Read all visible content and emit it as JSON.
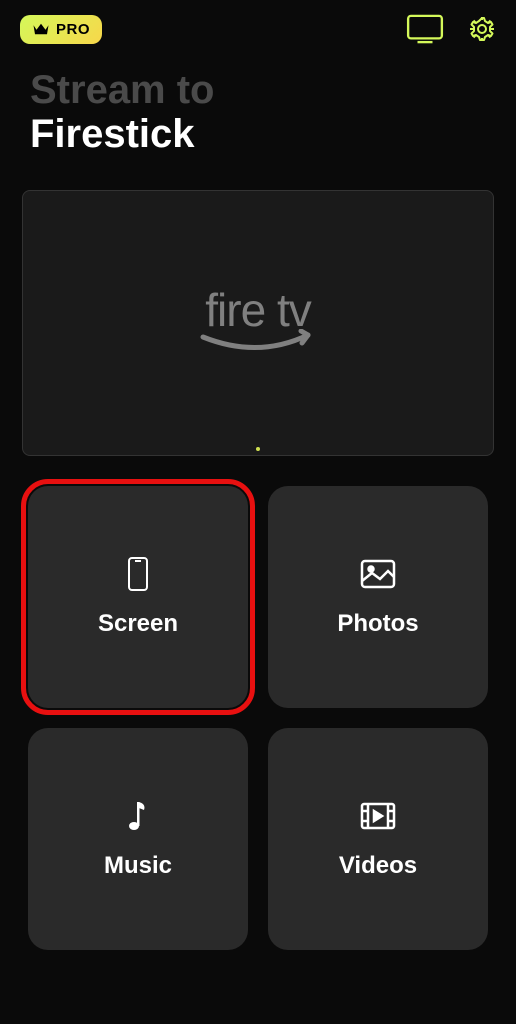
{
  "header": {
    "pro_label": "PRO"
  },
  "title": {
    "line1": "Stream to",
    "line2": "Firestick"
  },
  "preview": {
    "logo_text": "fire tv"
  },
  "tiles": [
    {
      "label": "Screen",
      "highlighted": true
    },
    {
      "label": "Photos",
      "highlighted": false
    },
    {
      "label": "Music",
      "highlighted": false
    },
    {
      "label": "Videos",
      "highlighted": false
    }
  ],
  "colors": {
    "accent": "#d4f85a",
    "highlight": "#e81010"
  }
}
